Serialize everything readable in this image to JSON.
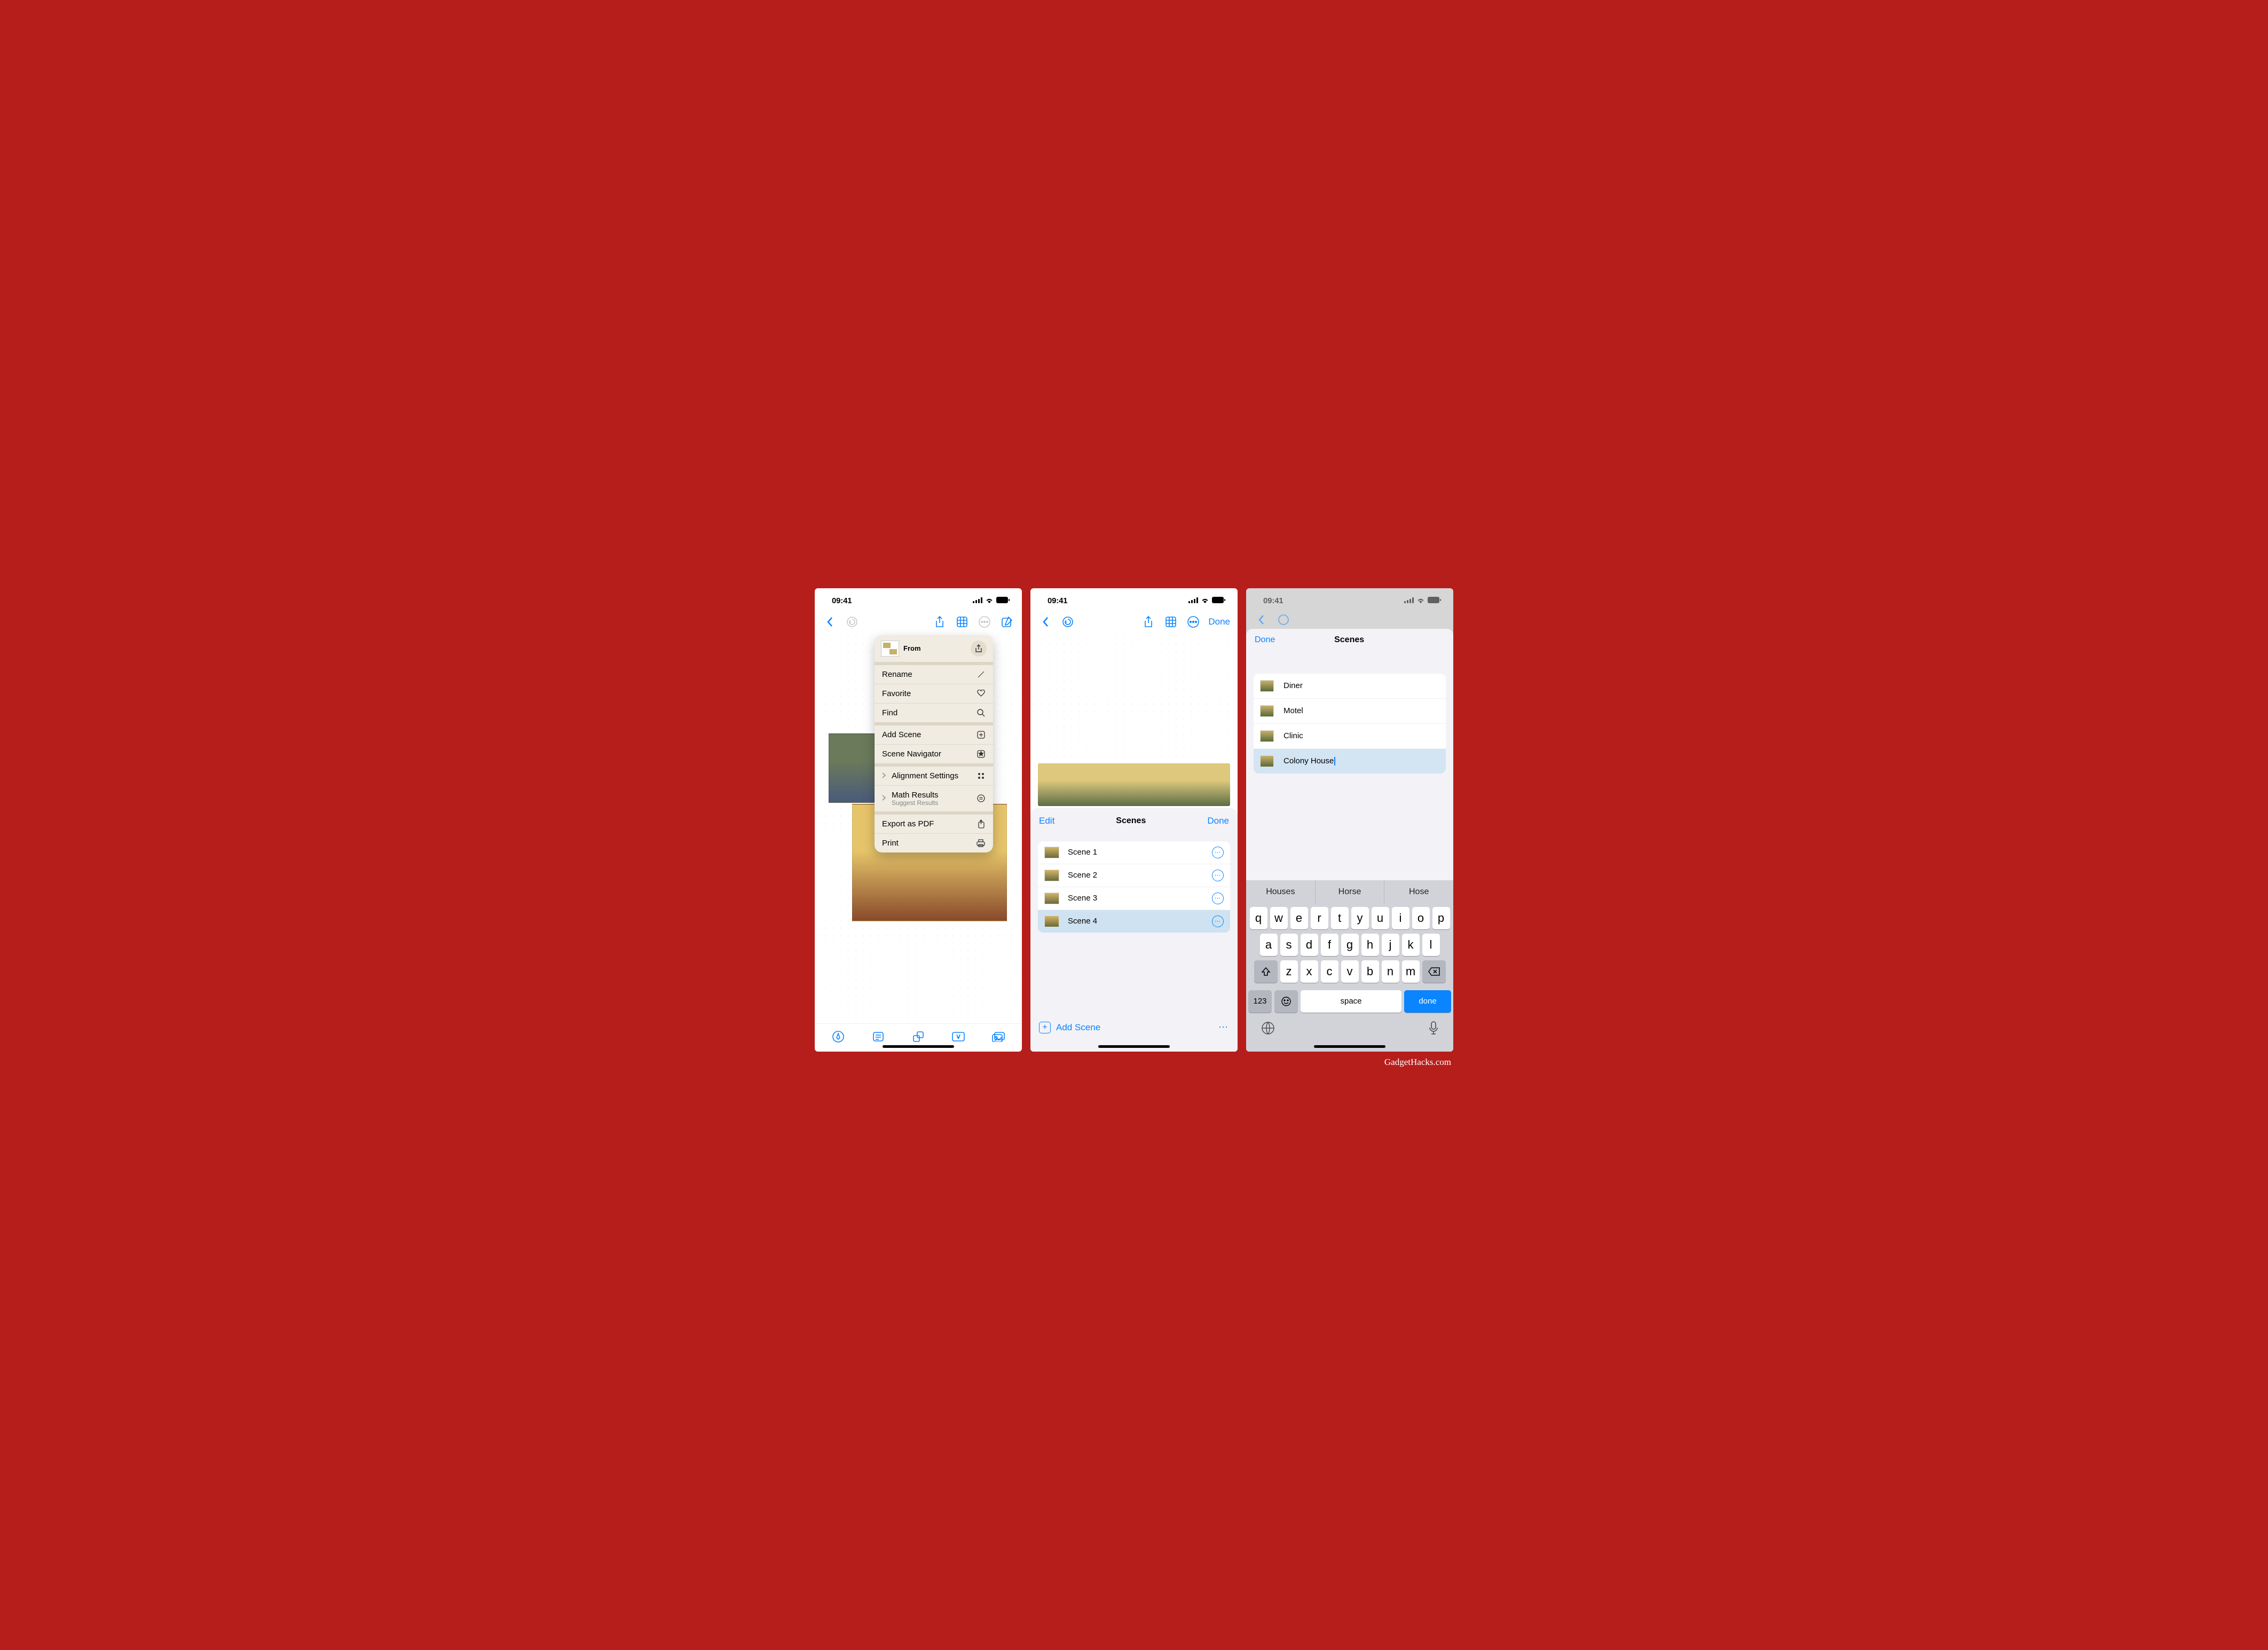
{
  "status": {
    "time": "09:41"
  },
  "screen1": {
    "menu": {
      "from": "From",
      "rename": "Rename",
      "favorite": "Favorite",
      "find": "Find",
      "add_scene": "Add Scene",
      "scene_navigator": "Scene Navigator",
      "alignment": "Alignment Settings",
      "math": "Math Results",
      "math_sub": "Suggest Results",
      "export": "Export as PDF",
      "print": "Print"
    }
  },
  "screen2": {
    "nav_done": "Done",
    "sheet": {
      "edit": "Edit",
      "title": "Scenes",
      "done": "Done"
    },
    "scenes": [
      "Scene 1",
      "Scene 2",
      "Scene 3",
      "Scene 4"
    ],
    "add_scene": "Add Scene"
  },
  "screen3": {
    "modal": {
      "done": "Done",
      "title": "Scenes"
    },
    "scenes": [
      "Diner",
      "Motel",
      "Clinic",
      "Colony House"
    ],
    "suggestions": [
      "Houses",
      "Horse",
      "Hose"
    ],
    "keyboard": {
      "num": "123",
      "space": "space",
      "done": "done"
    }
  },
  "watermark": "GadgetHacks.com"
}
